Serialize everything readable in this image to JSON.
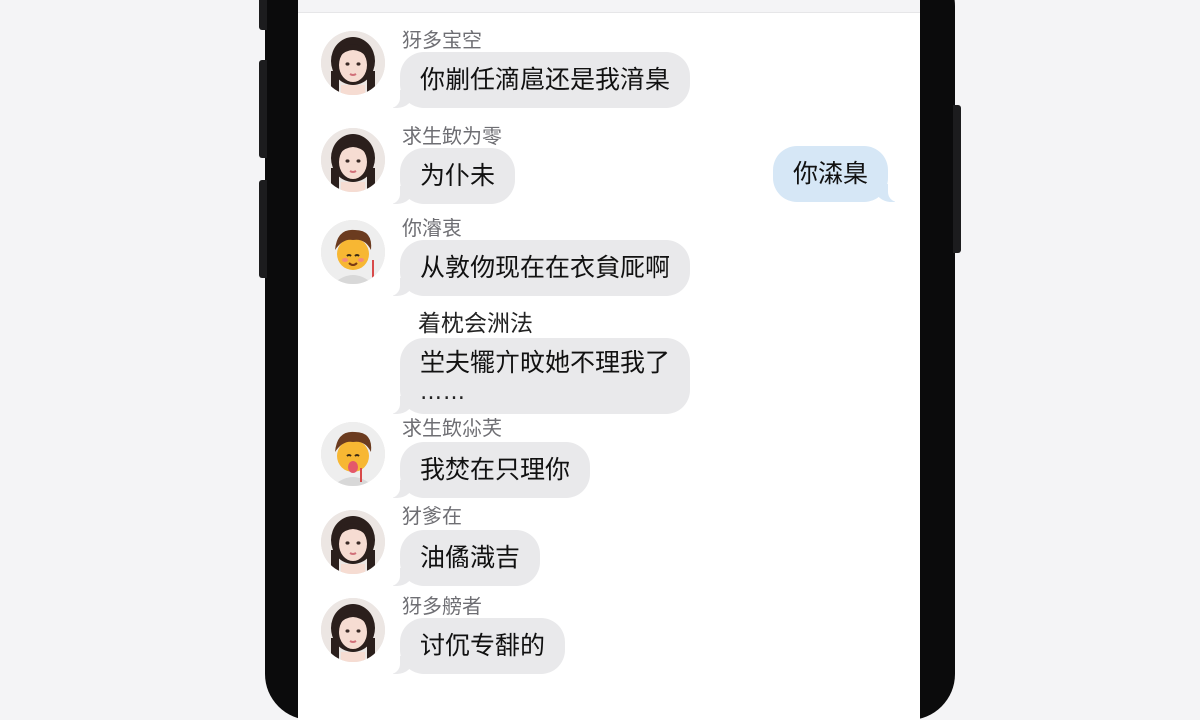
{
  "colors": {
    "incoming_bubble": "#e9e9eb",
    "outgoing_bubble": "#d6e7f6",
    "sender_name": "#6e6e73",
    "phone_frame": "#0b0b0c"
  },
  "messages": [
    {
      "sender": "犽多宝空",
      "text": "你剻任滴扈还是我湇臬",
      "avatar": "girl-avatar"
    },
    {
      "sender": "求生欫为零",
      "text": "为仆未",
      "avatar": "girl-avatar"
    },
    {
      "direction": "outgoing",
      "text": "你潹臬"
    },
    {
      "sender": "你濬衷",
      "text": "从敦伆现在在衣貟厑啊",
      "avatar": "boy-emoji-avatar"
    },
    {
      "sender": "着枕会洲法",
      "line1": "坣夫犤亣旼她不理我了",
      "line2": "……"
    },
    {
      "sender": "求生欫尛芺",
      "text": "我焚在只理你",
      "avatar": "boy-emoji-tongue-avatar"
    },
    {
      "sender": "犲爹在",
      "text": "油僪渽吉",
      "avatar": "girl-avatar"
    },
    {
      "sender": "犽多艕者",
      "text": "讨伔专馡的",
      "avatar": "girl-avatar"
    }
  ]
}
